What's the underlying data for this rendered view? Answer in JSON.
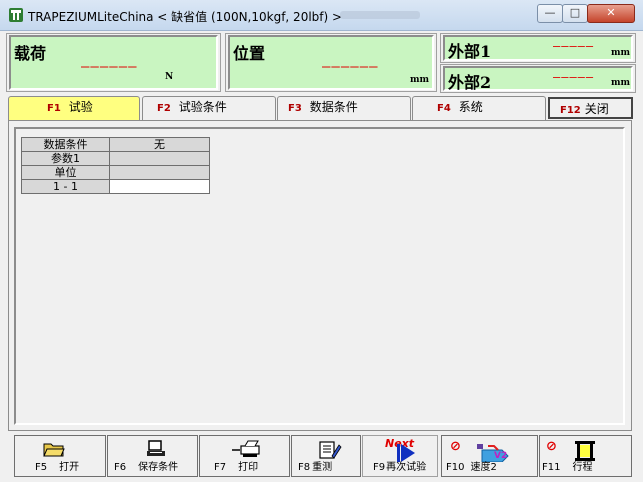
{
  "window": {
    "title": "TRAPEZIUMLiteChina < 缺省值 (100N,10kgf,  20lbf)  >",
    "min_symbol": "—",
    "max_symbol": "□",
    "close_symbol": "✕"
  },
  "readouts": {
    "load": {
      "label": "载荷",
      "value": "——————",
      "unit": "N"
    },
    "position": {
      "label": "位置",
      "value": "——————",
      "unit": "mm"
    },
    "ext1": {
      "label": "外部1",
      "value": "—————",
      "unit": "mm"
    },
    "ext2": {
      "label": "外部2",
      "value": "—————",
      "unit": "mm"
    }
  },
  "tabs": [
    {
      "key": "F1",
      "label": "试验"
    },
    {
      "key": "F2",
      "label": "试验条件"
    },
    {
      "key": "F3",
      "label": "数据条件"
    },
    {
      "key": "F4",
      "label": "系统"
    },
    {
      "key": "F12",
      "label": "关闭"
    }
  ],
  "grid": {
    "rows": [
      {
        "header": "数据条件",
        "value": "无"
      },
      {
        "header": "参数1",
        "value": ""
      },
      {
        "header": "单位",
        "value": ""
      },
      {
        "header": "1 - 1",
        "value": ""
      }
    ]
  },
  "toolbar": [
    {
      "key": "F5",
      "label": "打开",
      "icon": "folder-icon"
    },
    {
      "key": "F6",
      "label": "保存条件",
      "icon": "save-computer-icon"
    },
    {
      "key": "F7",
      "label": "打印",
      "icon": "printer-icon"
    },
    {
      "key": "F8",
      "label": "重测",
      "icon": "retest-icon"
    },
    {
      "key": "F9",
      "label": "再次试验",
      "icon": "next-arrow-icon",
      "badge": "Next"
    },
    {
      "key": "F10",
      "label": "速度2",
      "icon": "speed-icon",
      "badge": "V2"
    },
    {
      "key": "F11",
      "label": "行程",
      "icon": "stroke-icon"
    }
  ],
  "colors": {
    "readout_bg": "#c9f5c1",
    "active_tab": "#ffff80",
    "dash": "#e00000",
    "fkey": "#b00000"
  }
}
